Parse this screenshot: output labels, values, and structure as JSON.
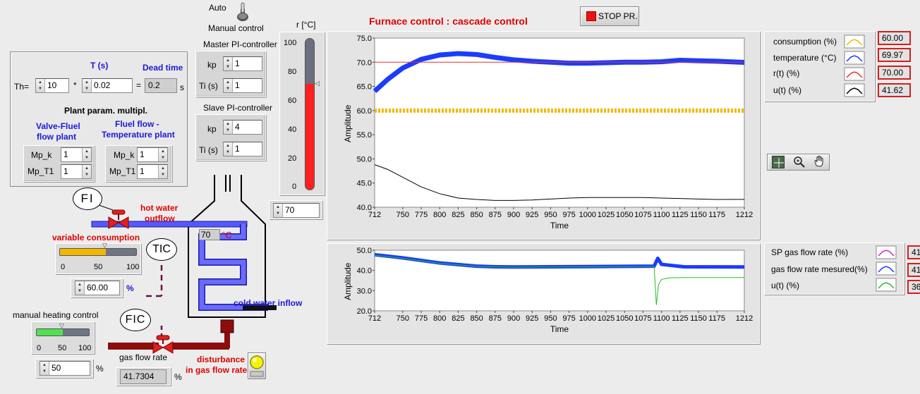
{
  "top": {
    "auto_label": "Auto",
    "manual_label": "Manual control",
    "title": "Furnace control : cascade control",
    "stop_label": "STOP PR."
  },
  "plant": {
    "th_label": "Th=",
    "th_value": "10",
    "t_header": "T (s)",
    "t_value": "0.02",
    "mult": "*",
    "eq": "=",
    "dead_header": "Dead time",
    "dead_value": "0.2",
    "s_unit": "s",
    "param_title": "Plant param. multipl.",
    "valve_title_1": "Valve-Fluel",
    "valve_title_2": "flow plant",
    "temp_title_1": "Fluel flow -",
    "temp_title_2": "Temperature  plant",
    "mpk_label": "Mp_k",
    "mpt1_label": "Mp_T1",
    "valve_mpk": "1",
    "valve_mpt1": "1",
    "temp_mpk": "1",
    "temp_mpt1": "1"
  },
  "master": {
    "title": "Master PI-controller",
    "kp_label": "kp",
    "kp": "1",
    "ti_label": "Ti (s)",
    "ti": "1"
  },
  "slave": {
    "title": "Slave PI-controller",
    "kp_label": "kp",
    "kp": "4",
    "ti_label": "Ti (s)",
    "ti": "1"
  },
  "setpoint": {
    "label": "r [°C]",
    "ticks": [
      "100",
      "80",
      "60",
      "40",
      "20",
      "0"
    ],
    "value_input": "70",
    "level_percent": 70
  },
  "process": {
    "fi": "FI",
    "tic": "TIC",
    "fic": "FIC",
    "hot_water_1": "hot water",
    "hot_water_2": "outflow",
    "variable_consumption": "variable consumption",
    "consumption_ticks": [
      "0",
      "50",
      "100"
    ],
    "consumption_value": "60.00",
    "consumption_unit": "%",
    "consumption_level": 60,
    "temp_value": "70",
    "temp_unit": "°C",
    "cold_water": "cold water inflow",
    "manual_heating": "manual heating control",
    "heating_ticks": [
      "0",
      "50",
      "100"
    ],
    "heating_value": "50",
    "heating_unit": "%",
    "heating_level": 50,
    "gas_flow_label": "gas flow rate",
    "gas_flow_value": "41.7304",
    "gas_flow_unit": "%",
    "disturbance_1": "disturbance",
    "disturbance_2": "in gas flow rate"
  },
  "chart_data": [
    {
      "type": "line",
      "title": "",
      "xlabel": "Time",
      "ylabel": "Amplitude",
      "xlim": [
        712,
        1212
      ],
      "ylim": [
        40,
        75
      ],
      "x_ticks": [
        "712",
        "750",
        "775",
        "800",
        "825",
        "850",
        "875",
        "900",
        "925",
        "950",
        "975",
        "1000",
        "1025",
        "1050",
        "1075",
        "1100",
        "1125",
        "1150",
        "1175",
        "1212"
      ],
      "y_ticks": [
        "75.0",
        "70.0",
        "65.0",
        "60.0",
        "55.0",
        "50.0",
        "45.0",
        "40.0"
      ],
      "series": [
        {
          "name": "consumption (%)",
          "color": "#f5b800",
          "x": [
            712,
            1212
          ],
          "values": [
            60,
            60
          ]
        },
        {
          "name": "temperature (°C)",
          "color": "#1a3cff",
          "x": [
            712,
            730,
            750,
            775,
            800,
            825,
            850,
            875,
            900,
            925,
            950,
            975,
            1000,
            1025,
            1050,
            1075,
            1100,
            1125,
            1150,
            1175,
            1212
          ],
          "values": [
            64,
            66.5,
            68.8,
            70.6,
            71.5,
            71.8,
            71.6,
            71.0,
            70.5,
            70.2,
            70.0,
            69.8,
            69.8,
            69.9,
            70.0,
            70.0,
            70.1,
            70.4,
            70.3,
            70.2,
            69.97
          ]
        },
        {
          "name": "r(t) (%)",
          "color": "#e03030",
          "x": [
            712,
            1212
          ],
          "values": [
            70,
            70
          ]
        },
        {
          "name": "u(t) (%)",
          "color": "#000000",
          "x": [
            712,
            730,
            750,
            775,
            800,
            825,
            850,
            875,
            900,
            925,
            950,
            975,
            1000,
            1025,
            1050,
            1075,
            1100,
            1125,
            1150,
            1175,
            1212
          ],
          "values": [
            48.8,
            47.8,
            46.2,
            44.2,
            42.8,
            41.9,
            41.6,
            41.4,
            41.4,
            41.5,
            41.7,
            41.9,
            42.0,
            42.0,
            42.0,
            42.0,
            41.9,
            41.8,
            41.7,
            41.6,
            41.62
          ]
        }
      ],
      "legend_values": [
        "60.00",
        "69.97",
        "70.00",
        "41.62"
      ]
    },
    {
      "type": "line",
      "title": "",
      "xlabel": "Time",
      "ylabel": "Amplitude",
      "xlim": [
        712,
        1212
      ],
      "ylim": [
        20,
        50
      ],
      "x_ticks": [
        "712",
        "750",
        "775",
        "800",
        "825",
        "850",
        "875",
        "900",
        "925",
        "950",
        "975",
        "1000",
        "1025",
        "1050",
        "1075",
        "1100",
        "1125",
        "1150",
        "1175",
        "1212"
      ],
      "y_ticks": [
        "50.0",
        "40.0",
        "30.0",
        "20.0"
      ],
      "series": [
        {
          "name": "SP gas flow rate  (%)",
          "color": "#d020d0",
          "x": [
            712,
            750,
            800,
            850,
            875,
            900,
            950,
            1000,
            1050,
            1090,
            1095,
            1100,
            1130,
            1212
          ],
          "values": [
            47.5,
            46.0,
            43.5,
            42.0,
            41.7,
            41.6,
            41.7,
            41.8,
            41.9,
            42.0,
            44.5,
            42.5,
            41.5,
            41.7
          ]
        },
        {
          "name": "gas flow rate  mesured(%)",
          "color": "#1a3cff",
          "x": [
            712,
            750,
            800,
            850,
            875,
            900,
            950,
            1000,
            1050,
            1090,
            1095,
            1100,
            1130,
            1212
          ],
          "values": [
            47.8,
            46.2,
            43.7,
            42.1,
            41.8,
            41.7,
            41.8,
            41.9,
            42.0,
            42.1,
            46.0,
            43.0,
            41.8,
            41.7
          ]
        },
        {
          "name": "u(t) (%)",
          "color": "#20c020",
          "x": [
            712,
            750,
            800,
            850,
            875,
            900,
            950,
            1000,
            1050,
            1090,
            1093,
            1096,
            1100,
            1110,
            1130,
            1212
          ],
          "values": [
            47.5,
            46.0,
            43.5,
            42.0,
            41.7,
            41.6,
            41.7,
            41.8,
            41.9,
            42.0,
            23.0,
            33.0,
            35.5,
            36.3,
            36.5,
            36.5
          ]
        }
      ],
      "legend_values": [
        "41.",
        "41.",
        "36."
      ]
    }
  ],
  "colors": {
    "title_red": "#e00000",
    "label_blue": "#1a1ad8",
    "pipe_blue": "#5858ff",
    "pipe_brown": "#8b0d0d",
    "slider_orange": "#f5b800",
    "slider_green": "#52e052",
    "tank_red": "#ff2020"
  },
  "icons": {
    "crosshair": "crosshair-icon",
    "zoom": "zoom-icon",
    "pan": "hand-pan-icon",
    "toggle": "toggle-switch-icon",
    "led": "led-icon"
  }
}
